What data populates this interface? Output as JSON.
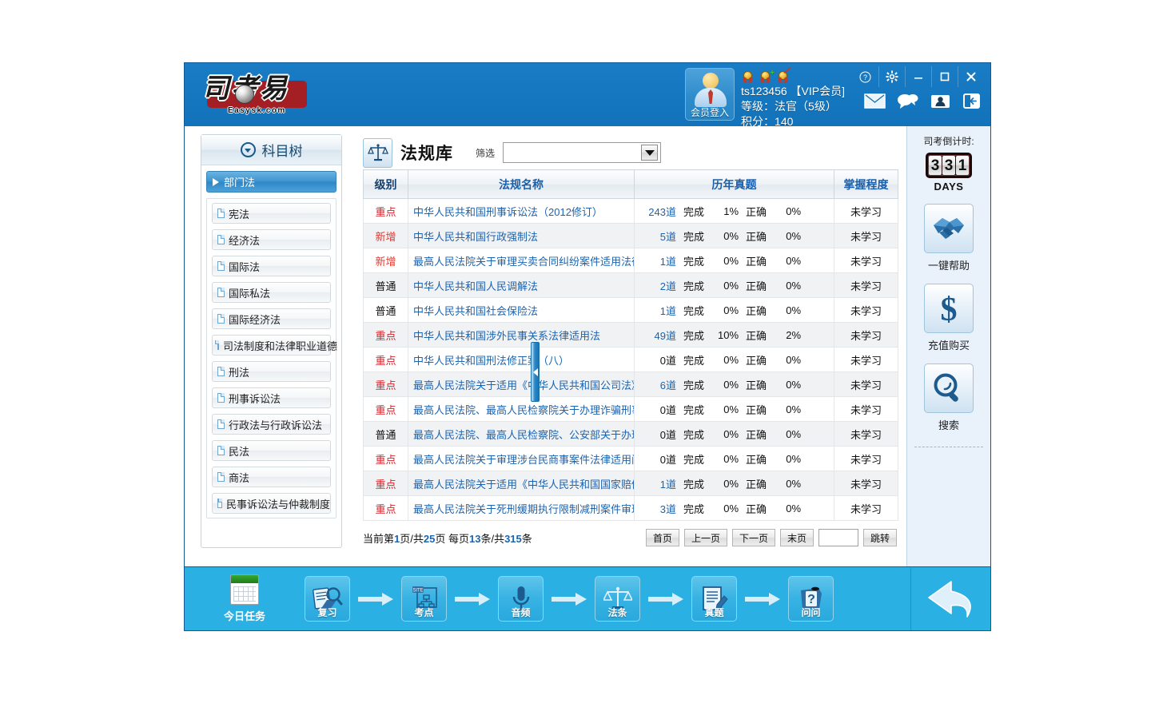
{
  "app": {
    "logo_chars": "司考易",
    "logo_url": "Easysk.com"
  },
  "titlebar": {
    "member_login_label": "会员登入",
    "username_line": "ts123456 【VIP会员]",
    "level_line": "等级：法官（5级）",
    "points_line": "积分：140",
    "win_buttons": [
      {
        "name": "help-button",
        "icon": "help-icon"
      },
      {
        "name": "settings-button",
        "icon": "gear-icon"
      },
      {
        "name": "minimize-button",
        "icon": "minimize-icon"
      },
      {
        "name": "maximize-button",
        "icon": "maximize-icon"
      },
      {
        "name": "close-button",
        "icon": "close-icon"
      }
    ],
    "quick_icons": [
      "mail-icon",
      "chat-icon",
      "contacts-icon",
      "logout-icon"
    ]
  },
  "sidebar": {
    "header_title": "科目树",
    "group": {
      "label": "部门法"
    },
    "items": [
      {
        "label": "宪法"
      },
      {
        "label": "经济法"
      },
      {
        "label": "国际法"
      },
      {
        "label": "国际私法"
      },
      {
        "label": "国际经济法"
      },
      {
        "label": "司法制度和法律职业道德"
      },
      {
        "label": "刑法"
      },
      {
        "label": "刑事诉讼法"
      },
      {
        "label": "行政法与行政诉讼法"
      },
      {
        "label": "民法"
      },
      {
        "label": "商法"
      },
      {
        "label": "民事诉讼法与仲裁制度"
      }
    ]
  },
  "main": {
    "title": "法规库",
    "filter_label": "筛选",
    "filter_value": "",
    "table": {
      "headers": [
        "级别",
        "法规名称",
        "历年真题",
        "掌握程度"
      ],
      "done_label": "完成",
      "correct_label": "正确",
      "unit": "道",
      "rows": [
        {
          "level": "重点",
          "level_type": "key",
          "name": "中华人民共和国刑事诉讼法（2012修订）",
          "count": "243",
          "done": "1%",
          "correct": "0%",
          "grade": "未学习"
        },
        {
          "level": "新增",
          "level_type": "new",
          "name": "中华人民共和国行政强制法",
          "count": "5",
          "done": "0%",
          "correct": "0%",
          "grade": "未学习"
        },
        {
          "level": "新增",
          "level_type": "new",
          "name": "最高人民法院关于审理买卖合同纠纷案件适用法律问题",
          "count": "1",
          "done": "0%",
          "correct": "0%",
          "grade": "未学习"
        },
        {
          "level": "普通",
          "level_type": "norm",
          "name": "中华人民共和国人民调解法",
          "count": "2",
          "done": "0%",
          "correct": "0%",
          "grade": "未学习"
        },
        {
          "level": "普通",
          "level_type": "norm",
          "name": "中华人民共和国社会保险法",
          "count": "1",
          "done": "0%",
          "correct": "0%",
          "grade": "未学习"
        },
        {
          "level": "重点",
          "level_type": "key",
          "name": "中华人民共和国涉外民事关系法律适用法",
          "count": "49",
          "done": "10%",
          "correct": "2%",
          "grade": "未学习"
        },
        {
          "level": "重点",
          "level_type": "key",
          "name": "中华人民共和国刑法修正案（八）",
          "count": "0",
          "done": "0%",
          "correct": "0%",
          "grade": "未学习"
        },
        {
          "level": "重点",
          "level_type": "key",
          "name": "最高人民法院关于适用《中华人民共和国公司法》若干",
          "count": "6",
          "done": "0%",
          "correct": "0%",
          "grade": "未学习"
        },
        {
          "level": "重点",
          "level_type": "key",
          "name": "最高人民法院、最高人民检察院关于办理诈骗刑事案件",
          "count": "0",
          "done": "0%",
          "correct": "0%",
          "grade": "未学习"
        },
        {
          "level": "普通",
          "level_type": "norm",
          "name": "最高人民法院、最高人民检察院、公安部关于办理侵犯",
          "count": "0",
          "done": "0%",
          "correct": "0%",
          "grade": "未学习"
        },
        {
          "level": "重点",
          "level_type": "key",
          "name": "最高人民法院关于审理涉台民商事案件法律适用问题的",
          "count": "0",
          "done": "0%",
          "correct": "0%",
          "grade": "未学习"
        },
        {
          "level": "重点",
          "level_type": "key",
          "name": "最高人民法院关于适用《中华人民共和国国家赔偿法》",
          "count": "1",
          "done": "0%",
          "correct": "0%",
          "grade": "未学习"
        },
        {
          "level": "重点",
          "level_type": "key",
          "name": "最高人民法院关于死刑缓期执行限制减刑案件审理程序",
          "count": "3",
          "done": "0%",
          "correct": "0%",
          "grade": "未学习"
        }
      ]
    },
    "pagination": {
      "prefix": "当前第",
      "current_page": "1",
      "mid1": "页/共",
      "total_pages": "25",
      "mid2": "页 每页",
      "per_page": "13",
      "mid3": "条/共",
      "total_items": "315",
      "suffix": "条",
      "first_label": "首页",
      "prev_label": "上一页",
      "next_label": "下一页",
      "last_label": "末页",
      "jump_value": "",
      "jump_label": "跳转"
    }
  },
  "right_panel": {
    "countdown_label": "司考倒计时:",
    "countdown_digits": [
      "3",
      "3",
      "1"
    ],
    "countdown_unit": "DAYS",
    "actions": [
      {
        "caption": "一键帮助",
        "icon": "handshake-icon"
      },
      {
        "caption": "充值购买",
        "icon": "dollar-icon"
      },
      {
        "caption": "搜索",
        "icon": "magnifier-icon"
      }
    ]
  },
  "bottom_bar": {
    "today_task_label": "今日任务",
    "steps": [
      {
        "label": "复习",
        "icon": "review-icon"
      },
      {
        "label": "考点",
        "icon": "site-map-icon"
      },
      {
        "label": "音频",
        "icon": "microphone-icon"
      },
      {
        "label": "法条",
        "icon": "scales-icon"
      },
      {
        "label": "真题",
        "icon": "exam-paper-icon"
      },
      {
        "label": "问问",
        "icon": "question-icon"
      }
    ],
    "back_icon": "back-arrow-icon"
  },
  "colors": {
    "title_blue": "#1577bf",
    "bottom_bar_blue": "#2bb0e4",
    "link_blue": "#1b63b0",
    "key_red": "#d5232a",
    "new_red": "#e8372f"
  }
}
